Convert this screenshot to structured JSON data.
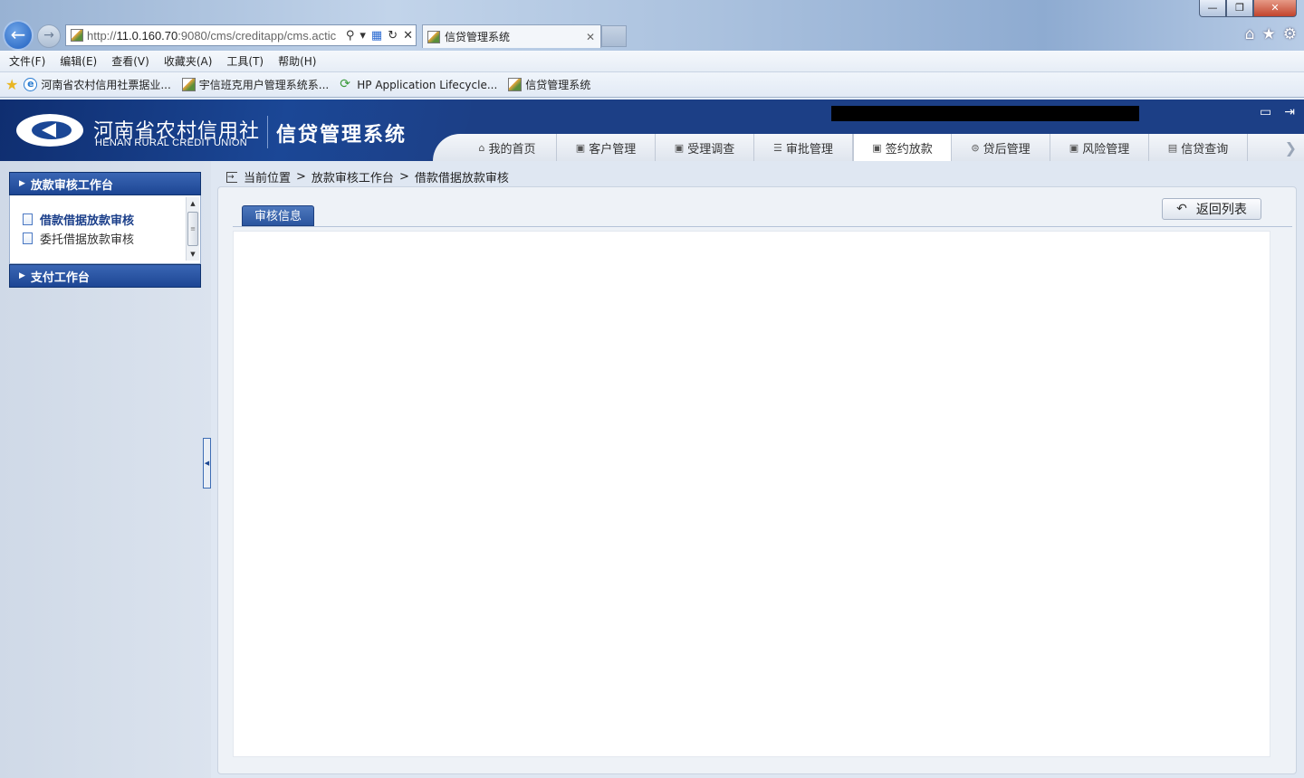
{
  "browser": {
    "url_prefix": "http://",
    "url_host": "11.0.160.70",
    "url_rest": ":9080/cms/creditapp/cms.actic",
    "tab_title": "信贷管理系统",
    "window_controls": {
      "minimize": "—",
      "restore": "❐",
      "close": "✕"
    },
    "menu": [
      "文件(F)",
      "编辑(E)",
      "查看(V)",
      "收藏夹(A)",
      "工具(T)",
      "帮助(H)"
    ],
    "favorites": [
      "河南省农村信用社票据业...",
      "宇信班克用户管理系统系...",
      "HP Application Lifecycle...",
      "信贷管理系统"
    ]
  },
  "app": {
    "org_cn": "河南省农村信用社",
    "org_en": "HENAN RURAL CREDIT UNION",
    "system_name": "信贷管理系统",
    "nav": [
      {
        "label": "我的首页",
        "icon": "home-icon",
        "glyph": "⌂"
      },
      {
        "label": "客户管理",
        "icon": "customer-icon",
        "glyph": "▣"
      },
      {
        "label": "受理调查",
        "icon": "survey-icon",
        "glyph": "▣"
      },
      {
        "label": "审批管理",
        "icon": "list-icon",
        "glyph": "☰"
      },
      {
        "label": "签约放款",
        "icon": "contract-icon",
        "glyph": "▣"
      },
      {
        "label": "贷后管理",
        "icon": "postloan-icon",
        "glyph": "⊜"
      },
      {
        "label": "风险管理",
        "icon": "risk-icon",
        "glyph": "▣"
      },
      {
        "label": "信贷查询",
        "icon": "query-icon",
        "glyph": "▤"
      }
    ],
    "active_nav": 4
  },
  "sidebar": {
    "panels": [
      {
        "title": "放款审核工作台",
        "items": [
          "借款借据放款审核",
          "委托借据放款审核"
        ],
        "active_item": 0
      },
      {
        "title": "支付工作台"
      }
    ]
  },
  "breadcrumb": {
    "items": [
      "当前位置",
      "放款审核工作台",
      "借款借据放款审核"
    ],
    "separator": ">"
  },
  "content": {
    "section_tab": "审核信息",
    "back_button": "返回列表"
  },
  "colors": {
    "header": "#1c3f86",
    "accent": "#2b559f"
  }
}
